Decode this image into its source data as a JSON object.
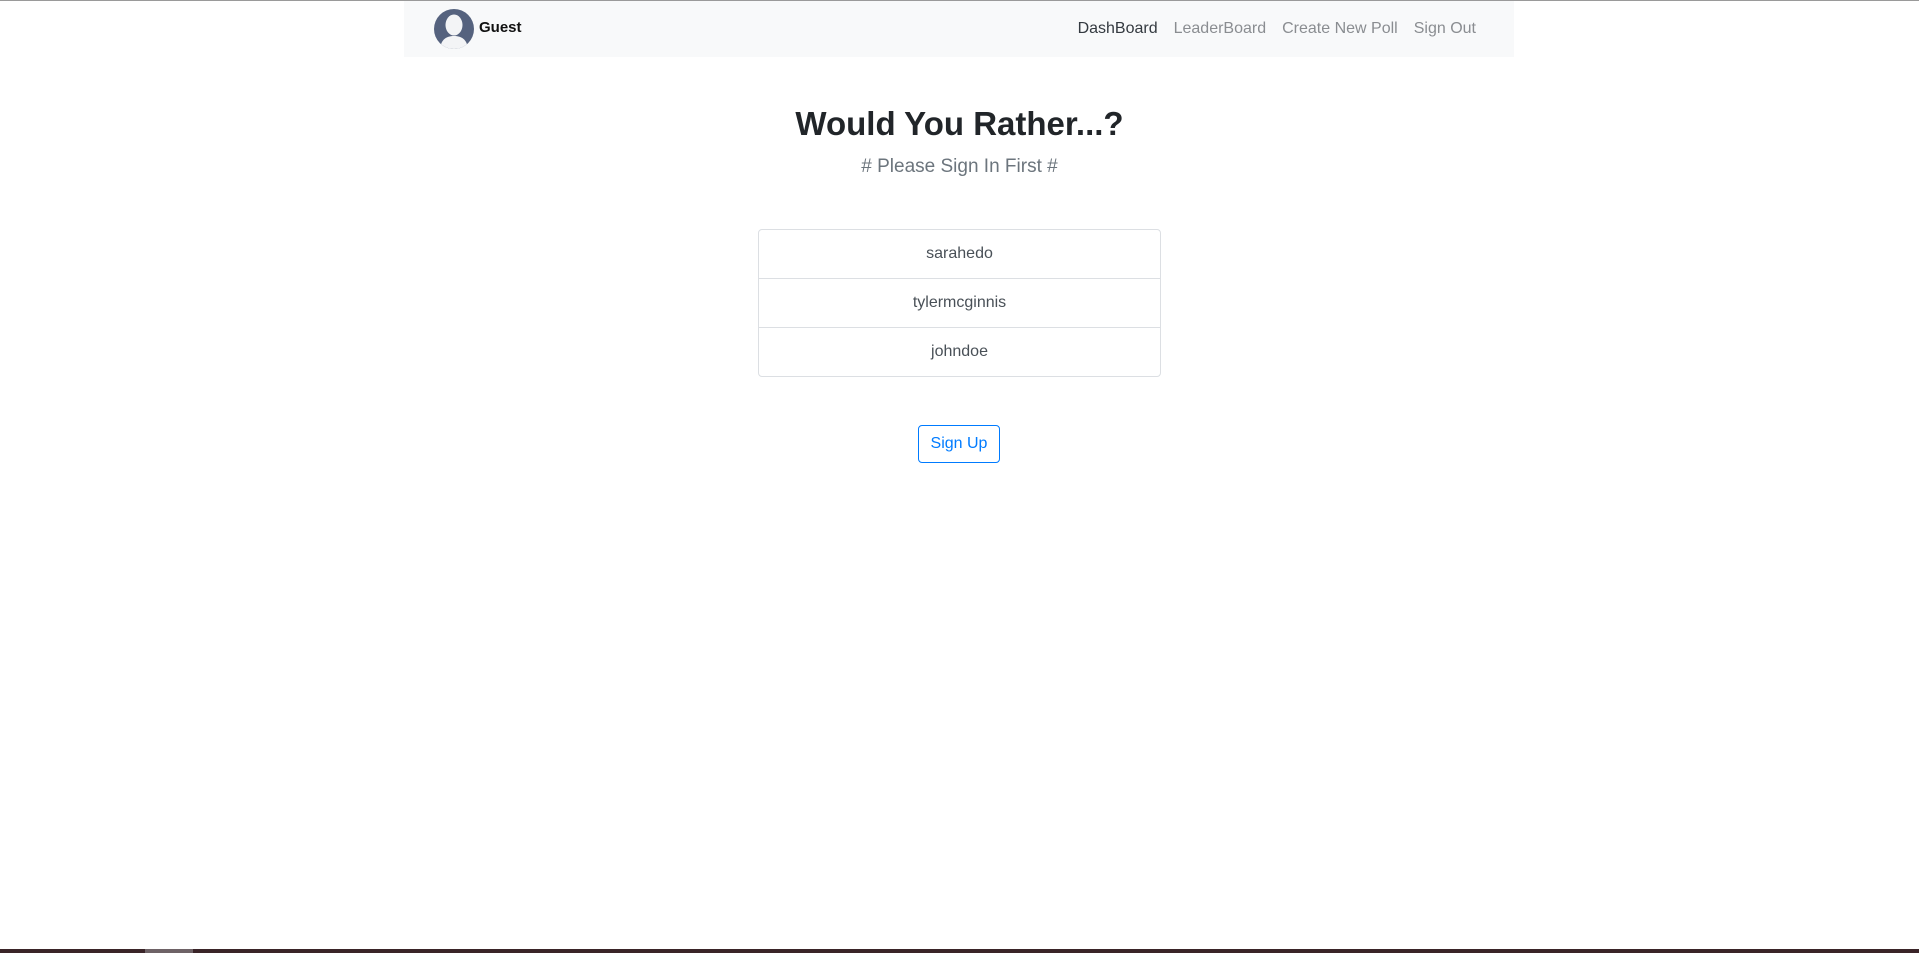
{
  "navbar": {
    "user_name": "Guest",
    "avatar_icon": "user-silhouette-icon",
    "links": [
      {
        "label": "DashBoard",
        "active": true
      },
      {
        "label": "LeaderBoard",
        "active": false
      },
      {
        "label": "Create New Poll",
        "active": false
      },
      {
        "label": "Sign Out",
        "active": false
      }
    ]
  },
  "main": {
    "title": "Would You Rather...?",
    "subtitle": "# Please Sign In First #",
    "users": [
      "sarahedo",
      "tylermcginnis",
      "johndoe"
    ],
    "signup_label": "Sign Up"
  },
  "colors": {
    "accent": "#007bff",
    "navbar_bg": "#f8f9fa",
    "avatar_bg": "#55627e"
  }
}
